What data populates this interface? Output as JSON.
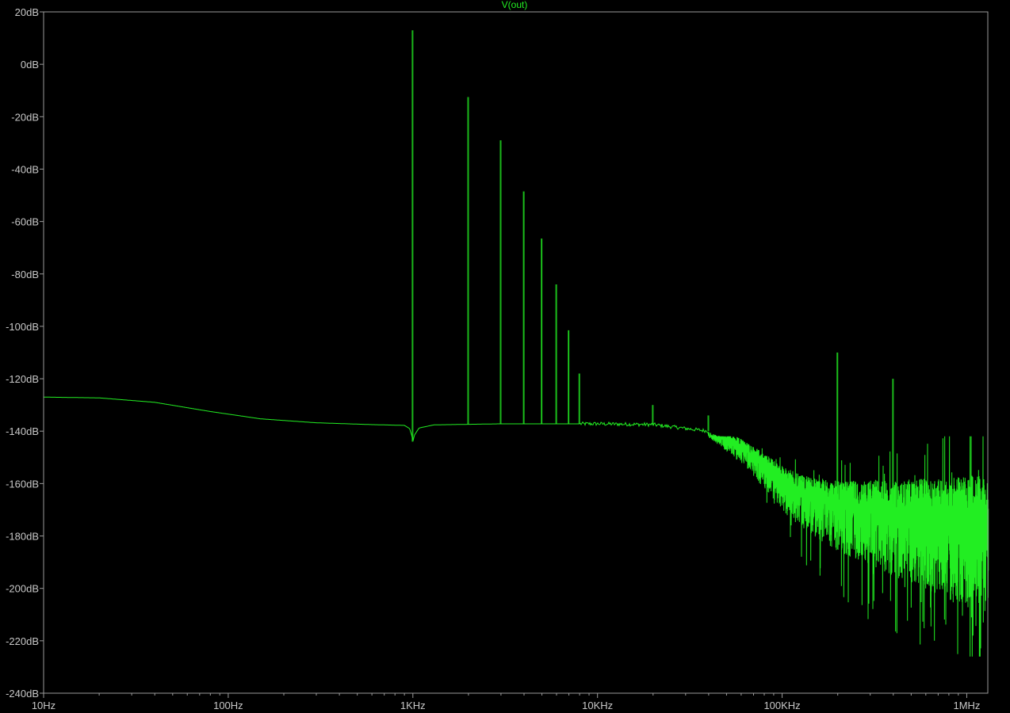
{
  "window": {
    "background": "#000000",
    "axis_color": "#9a9a9a",
    "label_color": "#c8c8c8"
  },
  "chart_data": {
    "type": "line",
    "title": "V(out)",
    "title_color": "#22ee22",
    "xlabel": "",
    "ylabel": "",
    "xscale": "log",
    "xlim": [
      10,
      1300000
    ],
    "ylim": [
      -240,
      20
    ],
    "grid": false,
    "xticks": [
      {
        "value": 10,
        "label": "10Hz"
      },
      {
        "value": 100,
        "label": "100Hz"
      },
      {
        "value": 1000,
        "label": "1KHz"
      },
      {
        "value": 10000,
        "label": "10KHz"
      },
      {
        "value": 100000,
        "label": "100KHz"
      },
      {
        "value": 1000000,
        "label": "1MHz"
      }
    ],
    "yticks": [
      {
        "value": 20,
        "label": "20dB"
      },
      {
        "value": 0,
        "label": "0dB"
      },
      {
        "value": -20,
        "label": "-20dB"
      },
      {
        "value": -40,
        "label": "-40dB"
      },
      {
        "value": -60,
        "label": "-60dB"
      },
      {
        "value": -80,
        "label": "-80dB"
      },
      {
        "value": -100,
        "label": "-100dB"
      },
      {
        "value": -120,
        "label": "-120dB"
      },
      {
        "value": -140,
        "label": "-140dB"
      },
      {
        "value": -160,
        "label": "-160dB"
      },
      {
        "value": -180,
        "label": "-180dB"
      },
      {
        "value": -200,
        "label": "-200dB"
      },
      {
        "value": -220,
        "label": "-220dB"
      },
      {
        "value": -240,
        "label": "-240dB"
      }
    ],
    "series": [
      {
        "name": "V(out)",
        "color": "#22ee22",
        "baseline": [
          {
            "x": 10,
            "y": -127
          },
          {
            "x": 20,
            "y": -127.3
          },
          {
            "x": 40,
            "y": -129
          },
          {
            "x": 80,
            "y": -132.5
          },
          {
            "x": 150,
            "y": -135.3
          },
          {
            "x": 300,
            "y": -136.8
          },
          {
            "x": 600,
            "y": -137.5
          },
          {
            "x": 900,
            "y": -137.8
          },
          {
            "x": 960,
            "y": -139
          },
          {
            "x": 990,
            "y": -142
          },
          {
            "x": 1000,
            "y": -144
          },
          {
            "x": 1020,
            "y": -141.5
          },
          {
            "x": 1080,
            "y": -138.8
          },
          {
            "x": 1300,
            "y": -137.6
          },
          {
            "x": 3000,
            "y": -137.2
          },
          {
            "x": 10000,
            "y": -137.2
          },
          {
            "x": 20000,
            "y": -137.5
          },
          {
            "x": 40000,
            "y": -140
          },
          {
            "x": 60000,
            "y": -146
          },
          {
            "x": 80000,
            "y": -153
          },
          {
            "x": 100000,
            "y": -159
          },
          {
            "x": 130000,
            "y": -164
          },
          {
            "x": 200000,
            "y": -168
          },
          {
            "x": 400000,
            "y": -171
          },
          {
            "x": 700000,
            "y": -173
          },
          {
            "x": 1300000,
            "y": -174
          }
        ],
        "spikes": [
          {
            "x": 1000,
            "y": 13
          },
          {
            "x": 2000,
            "y": -12.5
          },
          {
            "x": 3000,
            "y": -29
          },
          {
            "x": 4000,
            "y": -48.5
          },
          {
            "x": 5000,
            "y": -66.5
          },
          {
            "x": 6000,
            "y": -84
          },
          {
            "x": 7000,
            "y": -101.5
          },
          {
            "x": 8000,
            "y": -118
          },
          {
            "x": 20000,
            "y": -130
          },
          {
            "x": 40000,
            "y": -134
          },
          {
            "x": 200000,
            "y": -110
          },
          {
            "x": 400000,
            "y": -120
          }
        ],
        "noise": {
          "start_hz": 40000,
          "min_db": -226,
          "max_db": -142
        }
      }
    ]
  }
}
